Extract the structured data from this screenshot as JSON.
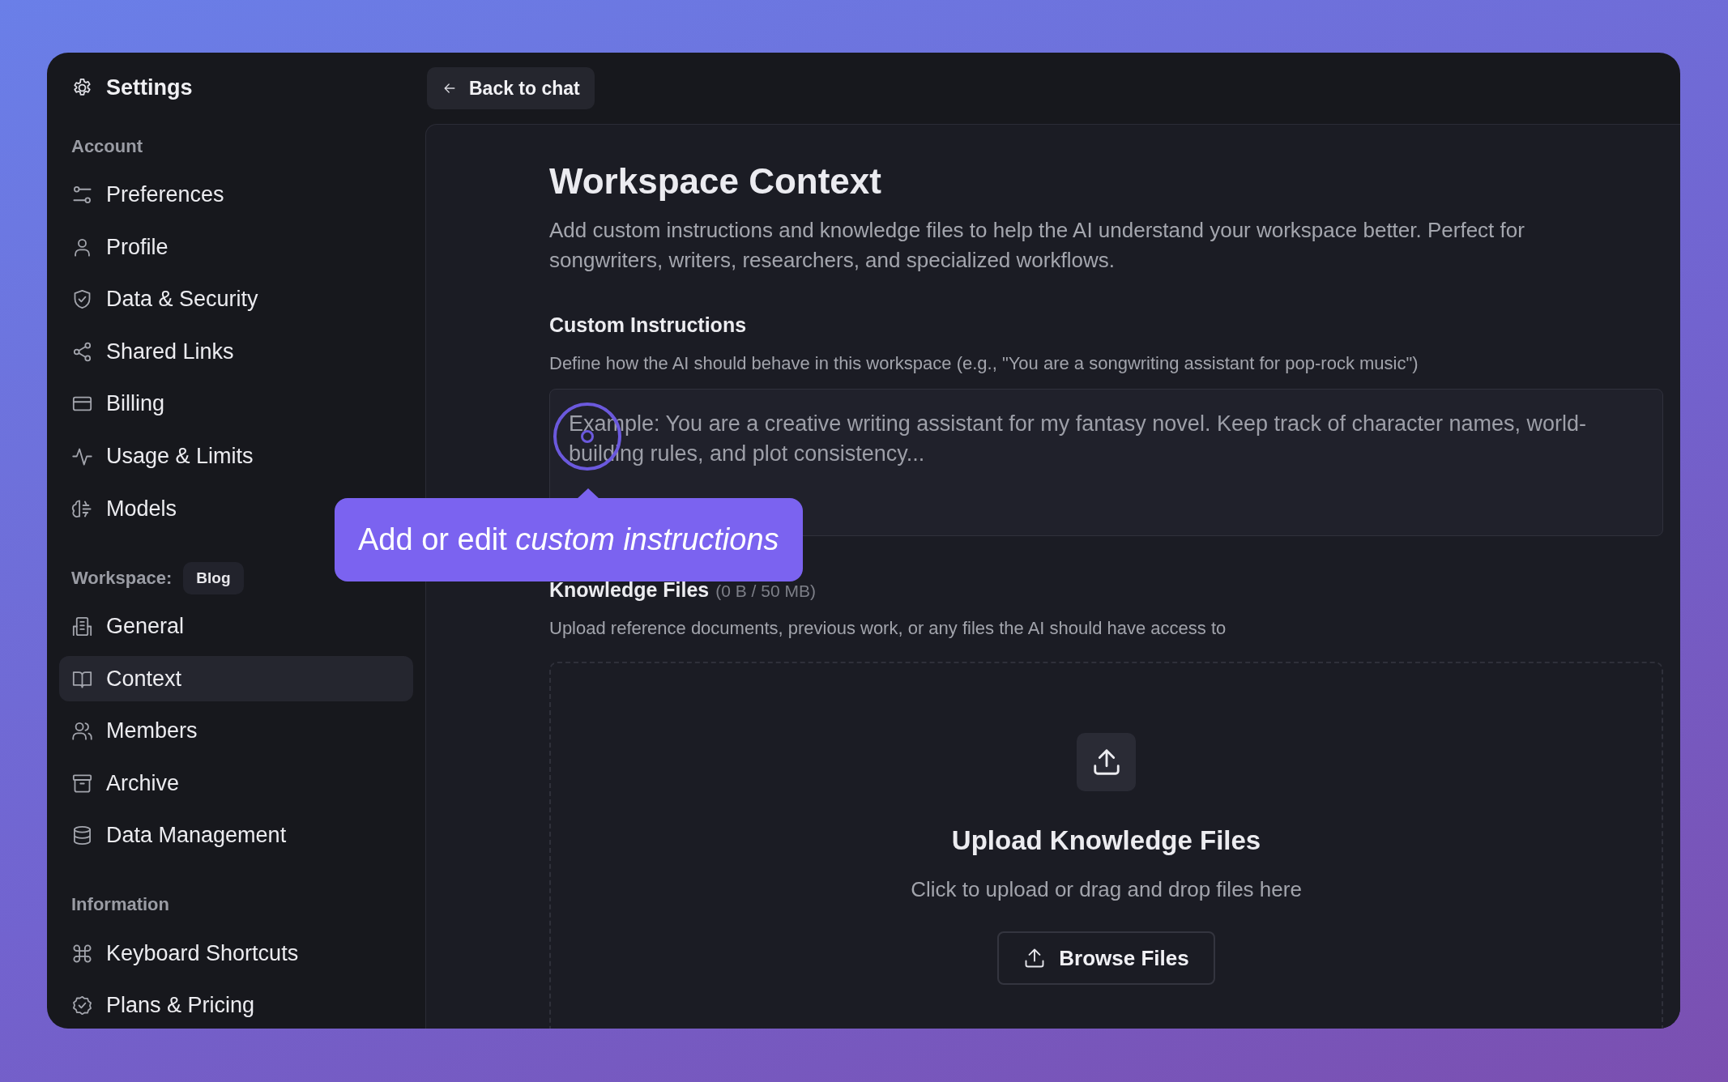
{
  "sidebar": {
    "title": "Settings",
    "sections": [
      {
        "label": "Account",
        "items": [
          {
            "label": "Preferences",
            "selected": false
          },
          {
            "label": "Profile",
            "selected": false
          },
          {
            "label": "Data & Security",
            "selected": false
          },
          {
            "label": "Shared Links",
            "selected": false
          },
          {
            "label": "Billing",
            "selected": false
          },
          {
            "label": "Usage & Limits",
            "selected": false
          },
          {
            "label": "Models",
            "selected": false
          }
        ]
      },
      {
        "label": "Workspace:",
        "badge": "Blog",
        "items": [
          {
            "label": "General",
            "selected": false
          },
          {
            "label": "Context",
            "selected": true
          },
          {
            "label": "Members",
            "selected": false
          },
          {
            "label": "Archive",
            "selected": false
          },
          {
            "label": "Data Management",
            "selected": false
          }
        ]
      },
      {
        "label": "Information",
        "items": [
          {
            "label": "Keyboard Shortcuts",
            "selected": false
          },
          {
            "label": "Plans & Pricing",
            "selected": false
          }
        ]
      }
    ]
  },
  "back_button": "Back to chat",
  "page": {
    "title": "Workspace Context",
    "description": "Add custom instructions and knowledge files to help the AI understand your workspace better. Perfect for songwriters, writers, researchers, and specialized workflows.",
    "custom_instructions": {
      "heading": "Custom Instructions",
      "hint": "Define how the AI should behave in this workspace (e.g., \"You are a songwriting assistant for pop-rock music\")",
      "placeholder": "Example: You are a creative writing assistant for my fantasy novel. Keep track of character names, world-building rules, and plot consistency..."
    },
    "knowledge_files": {
      "heading": "Knowledge Files",
      "size": "(0 B / 50 MB)",
      "hint": "Upload reference documents, previous work, or any files the AI should have access to"
    },
    "upload": {
      "title": "Upload Knowledge Files",
      "subtitle": "Click to upload or drag and drop files here",
      "button": "Browse Files"
    }
  },
  "tooltip": {
    "text": "Add or edit *custom instructions*"
  }
}
